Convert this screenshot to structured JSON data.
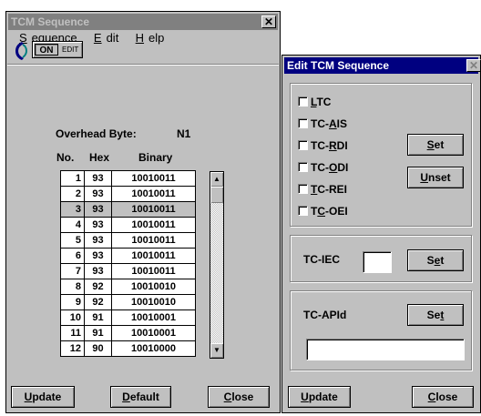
{
  "seq_window": {
    "title": "TCM Sequence",
    "menu": [
      "Sequence",
      "Edit",
      "Help"
    ],
    "toggle": {
      "on_label": "ON",
      "edit_label": "EDIT"
    },
    "overhead_label": "Overhead Byte:",
    "overhead_value": "N1",
    "columns": [
      "No.",
      "Hex",
      "Binary"
    ],
    "rows": [
      {
        "no": "1",
        "hex": "93",
        "bin": "10010011"
      },
      {
        "no": "2",
        "hex": "93",
        "bin": "10010011"
      },
      {
        "no": "3",
        "hex": "93",
        "bin": "10010011"
      },
      {
        "no": "4",
        "hex": "93",
        "bin": "10010011"
      },
      {
        "no": "5",
        "hex": "93",
        "bin": "10010011"
      },
      {
        "no": "6",
        "hex": "93",
        "bin": "10010011"
      },
      {
        "no": "7",
        "hex": "93",
        "bin": "10010011"
      },
      {
        "no": "8",
        "hex": "92",
        "bin": "10010010"
      },
      {
        "no": "9",
        "hex": "92",
        "bin": "10010010"
      },
      {
        "no": "10",
        "hex": "91",
        "bin": "10010001"
      },
      {
        "no": "11",
        "hex": "91",
        "bin": "10010001"
      },
      {
        "no": "12",
        "hex": "90",
        "bin": "10010000"
      }
    ],
    "selected_row": 3,
    "buttons": {
      "update": "Update",
      "default": "Default",
      "close": "Close"
    }
  },
  "edit_window": {
    "title": "Edit TCM Sequence",
    "checkboxes": [
      "LTC",
      "TC-AIS",
      "TC-RDI",
      "TC-ODI",
      "TC-REI",
      "TC-OEI"
    ],
    "set_label": "Set",
    "unset_label": "Unset",
    "tciec_label": "TC-IEC",
    "tciec_set": "Set",
    "tcapid_label": "TC-APId",
    "tcapid_set": "Set",
    "buttons": {
      "update": "Update",
      "close": "Close"
    }
  },
  "colors": {
    "window_bg": "#c0c0c0",
    "active_title": "#000080",
    "inactive_title": "#808080"
  },
  "icons": {
    "app": "tcm-app-icon"
  }
}
